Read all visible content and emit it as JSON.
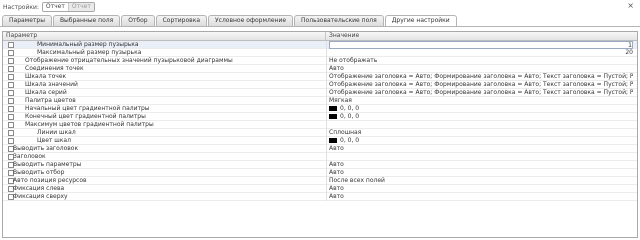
{
  "topbar": {
    "label": "Настройки:",
    "seg_active": "Отчет",
    "seg_inactive": "Отчет",
    "close_glyph": "×"
  },
  "tabs": [
    {
      "label": "Параметры"
    },
    {
      "label": "Выбранные поля"
    },
    {
      "label": "Отбор"
    },
    {
      "label": "Сортировка"
    },
    {
      "label": "Условное оформление"
    },
    {
      "label": "Пользовательские поля"
    },
    {
      "label": "Другие настройки"
    }
  ],
  "grid": {
    "header": {
      "param": "Параметр",
      "value": "Значение"
    },
    "rows": [
      {
        "param": "Минимальный размер пузырька",
        "value": "1",
        "level": 2,
        "checkbox": true
      },
      {
        "param": "Максимальный размер пузырька",
        "value": "20",
        "level": 2,
        "checkbox": true
      },
      {
        "param": "Отображение отрицательных значений пузырьковой диаграммы",
        "value": "Не отображать",
        "level": 1,
        "checkbox": true
      },
      {
        "param": "Соединения точек",
        "value": "Авто",
        "level": 1,
        "checkbox": true
      },
      {
        "param": "Шкала точек",
        "value": "Отображение заголовка = Авто; Формирование заголовка = Авто; Текст заголовка = Пустой; Расположение заголовка",
        "level": 1,
        "checkbox": true
      },
      {
        "param": "Шкала значений",
        "value": "Отображение заголовка = Авто; Формирование заголовка = Авто; Текст заголовка = Пустой; Расположение заголовка",
        "level": 1,
        "checkbox": true
      },
      {
        "param": "Шкала серий",
        "value": "Отображение заголовка = Авто; Формирование заголовка = Авто; Текст заголовка = Пустой; Расположение заголовка",
        "level": 1,
        "checkbox": true
      },
      {
        "param": "Палитра цветов",
        "value": "Мягкая",
        "level": 1,
        "checkbox": true
      },
      {
        "param": "Начальный цвет градиентной палитры",
        "value": "0, 0, 0",
        "level": 1,
        "checkbox": true,
        "swatch": true
      },
      {
        "param": "Конечный цвет градиентной палитры",
        "value": "0, 0, 0",
        "level": 1,
        "checkbox": true,
        "swatch": true
      },
      {
        "param": "Максимум цветов градиентной палитры",
        "value": "",
        "level": 1,
        "checkbox": true
      },
      {
        "param": "Линии шкал",
        "value": "Сплошная",
        "level": 2,
        "checkbox": true
      },
      {
        "param": "Цвет шкал",
        "value": "0, 0, 0",
        "level": 2,
        "checkbox": true,
        "swatch": true
      },
      {
        "param": "Выводить заголовок",
        "value": "Авто",
        "level": 0,
        "checkbox": true
      },
      {
        "param": "Заголовок",
        "value": "",
        "level": 0,
        "checkbox": true
      },
      {
        "param": "Выводить параметры",
        "value": "Авто",
        "level": 0,
        "checkbox": true
      },
      {
        "param": "Выводить отбор",
        "value": "Авто",
        "level": 0,
        "checkbox": true
      },
      {
        "param": "Авто позиция ресурсов",
        "value": "После всех полей",
        "level": 0,
        "checkbox": true
      },
      {
        "param": "Фиксация слева",
        "value": "Авто",
        "level": 0,
        "checkbox": true
      },
      {
        "param": "Фиксация сверху",
        "value": "Авто",
        "level": 0,
        "checkbox": true
      }
    ]
  }
}
